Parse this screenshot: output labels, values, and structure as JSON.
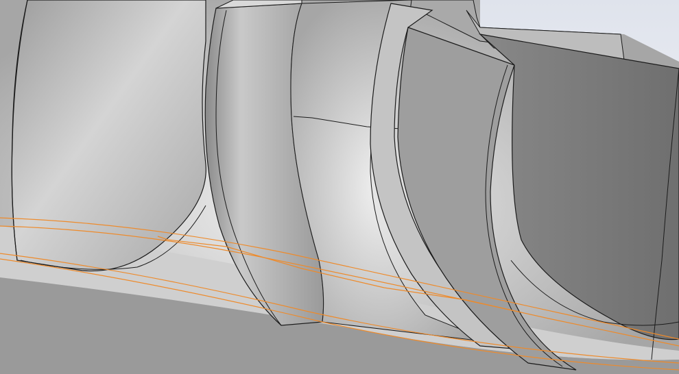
{
  "viewport": {
    "background_top": "#dfe3ec",
    "background_bottom": "#ffffff"
  },
  "model": {
    "body_color": "#b7b7b7",
    "body_light": "#e9e9e9",
    "body_dark": "#7c7c7c",
    "edge_color": "#1a1a1a",
    "selection_color": "#ee8a2a"
  }
}
